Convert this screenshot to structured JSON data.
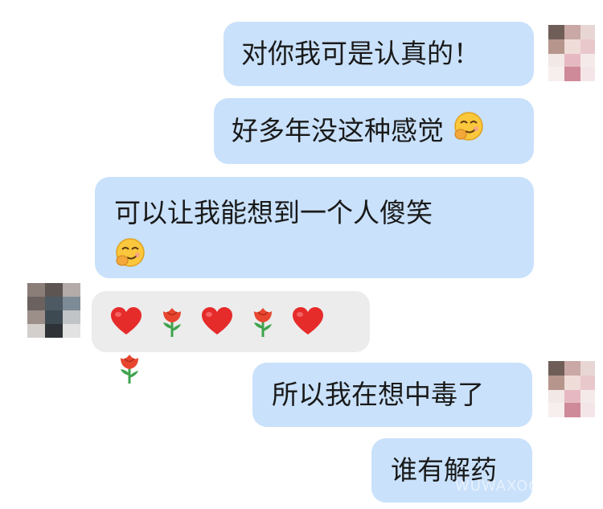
{
  "messages": [
    {
      "id": 1,
      "side": "right",
      "text": "对你我可是认真的！",
      "emoji_after": ""
    },
    {
      "id": 2,
      "side": "right",
      "text": "好多年没这种感觉",
      "emoji_after": "smirk-face"
    },
    {
      "id": 3,
      "side": "right",
      "text": "可以让我能想到一个人傻笑",
      "emoji_after": "smirk-face"
    },
    {
      "id": 4,
      "side": "left",
      "emojis": [
        "heart",
        "rose",
        "heart",
        "rose",
        "heart",
        "rose"
      ]
    },
    {
      "id": 5,
      "side": "right",
      "text": "所以我在想中毒了",
      "emoji_after": ""
    },
    {
      "id": 6,
      "side": "right",
      "text": "谁有解药",
      "emoji_after": ""
    }
  ],
  "watermark": "WUWAXOO",
  "colors": {
    "outgoing_bubble": "#c9e1fb",
    "incoming_bubble": "#ececec",
    "text": "#1a1a1a",
    "heart": "#e62b2b",
    "rose_petal": "#e8452f",
    "rose_stem": "#3fa34d"
  }
}
